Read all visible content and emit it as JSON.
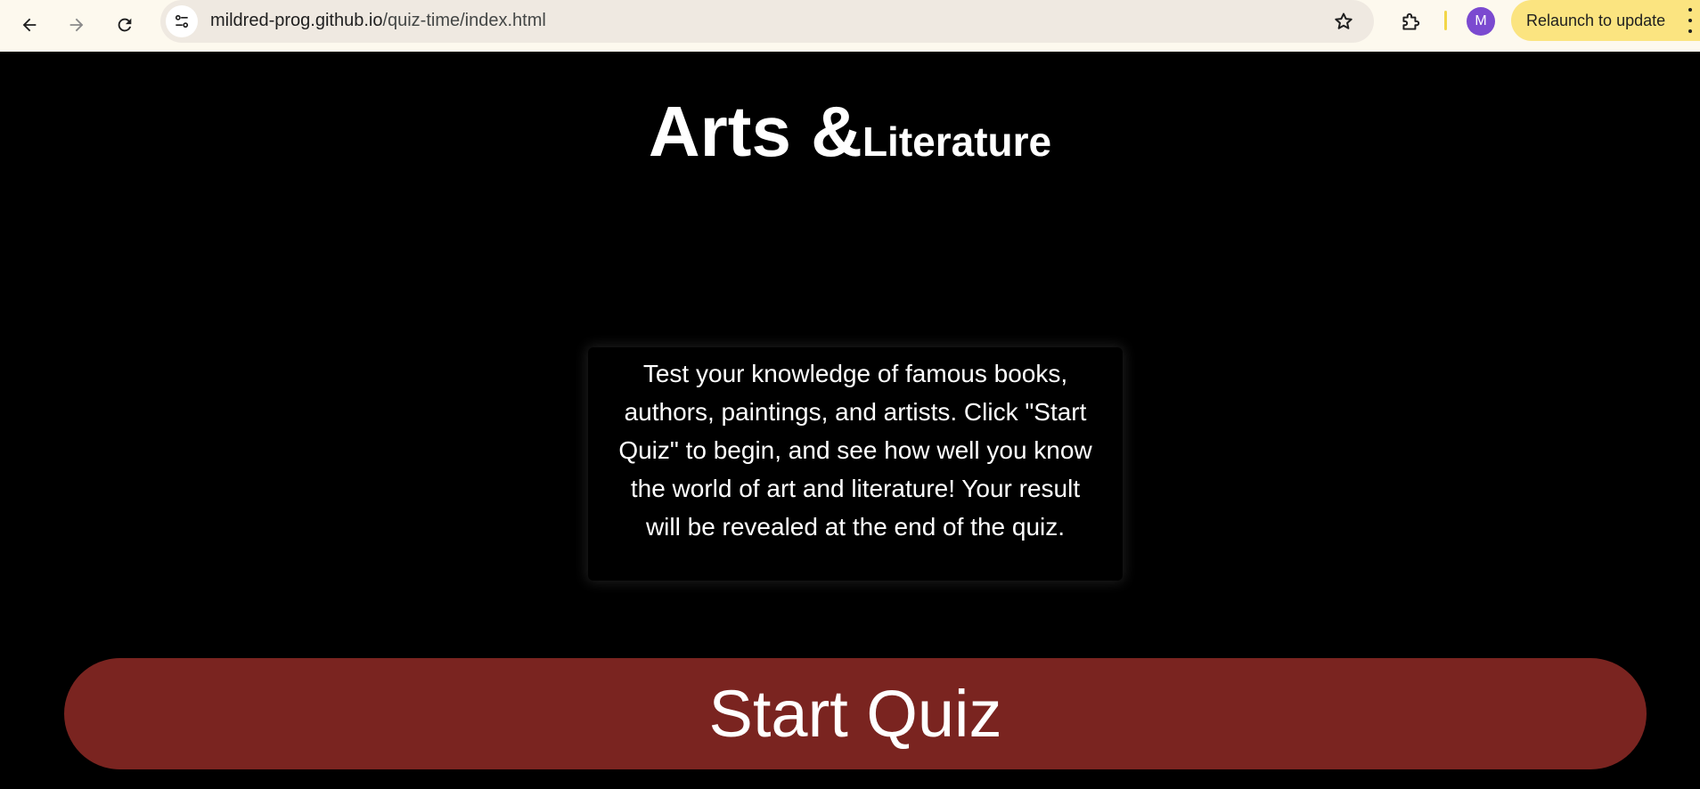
{
  "browser": {
    "back_icon": "arrow-left-icon",
    "forward_icon": "arrow-right-icon",
    "reload_icon": "reload-icon",
    "site_info_icon": "tune-icon",
    "url_host": "mildred-prog.github.io",
    "url_path": "/quiz-time/index.html",
    "bookmark_icon": "star-icon",
    "extensions_icon": "puzzle-icon",
    "profile_initial": "M",
    "relaunch_label": "Relaunch to update",
    "menu_icon": "kebab-icon"
  },
  "page": {
    "title_main": "Arts &",
    "title_sub": "Literature",
    "intro": "Test your knowledge of famous books, authors, paintings, and artists. Click \"Start Quiz\" to begin, and see how well you know the world of art and literature! Your result will be revealed at the end of the quiz.",
    "start_button_label": "Start Quiz"
  },
  "colors": {
    "page_background": "#000000",
    "text": "#ffffff",
    "start_button": "#7a2420",
    "chrome_background": "#fdf9ee",
    "omnibox": "#efe9e1",
    "relaunch_chip": "#fbe480",
    "avatar": "#7b4ad0"
  }
}
